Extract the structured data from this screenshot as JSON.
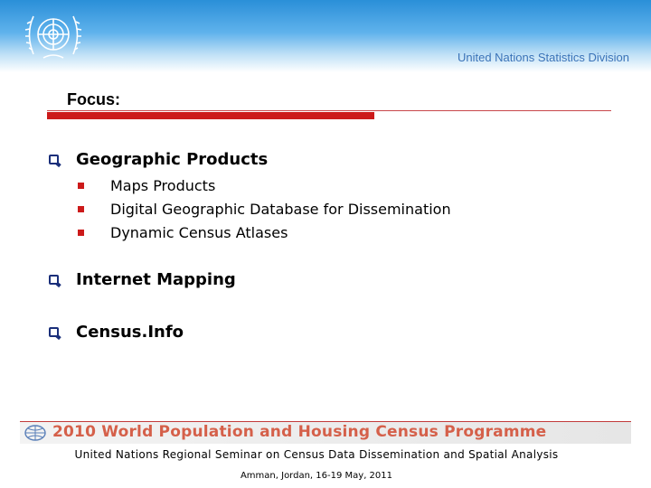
{
  "header": {
    "division": "United Nations Statistics Division",
    "logo_icon": "un-emblem-icon"
  },
  "slide": {
    "title": "Focus:",
    "items": [
      {
        "label": "Geographic Products",
        "subitems": [
          "Maps Products",
          "Digital Geographic Database for Dissemination",
          "Dynamic Census Atlases"
        ]
      },
      {
        "label": "Internet Mapping"
      },
      {
        "label": "Census.Info"
      }
    ]
  },
  "footer": {
    "banner": "2010 World Population and Housing Census Programme",
    "seminar": "United Nations Regional Seminar on Census Data Dissemination and Spatial Analysis",
    "location": "Amman, Jordan, 16-19 May, 2011"
  },
  "colors": {
    "accent": "#cc1a1a",
    "header_blue": "#2a8fd8",
    "bullet": "#1a2f7a",
    "banner_text": "#d5604a"
  }
}
